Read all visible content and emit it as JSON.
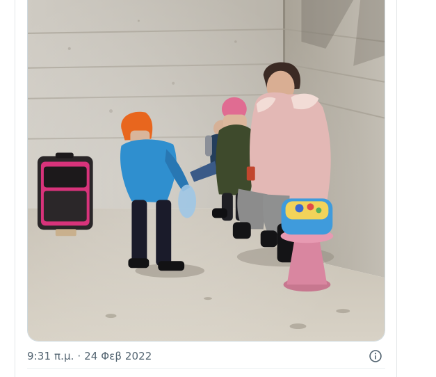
{
  "tweet": {
    "timestamp": "9:31 π.μ. · 24 Φεβ 2022",
    "media_type": "photo"
  },
  "icons": {
    "info": "info-circle-icon"
  },
  "colors": {
    "meta_text": "#536471",
    "border": "#cfd9de",
    "divider": "#eff3f4",
    "icon": "#536471"
  }
}
